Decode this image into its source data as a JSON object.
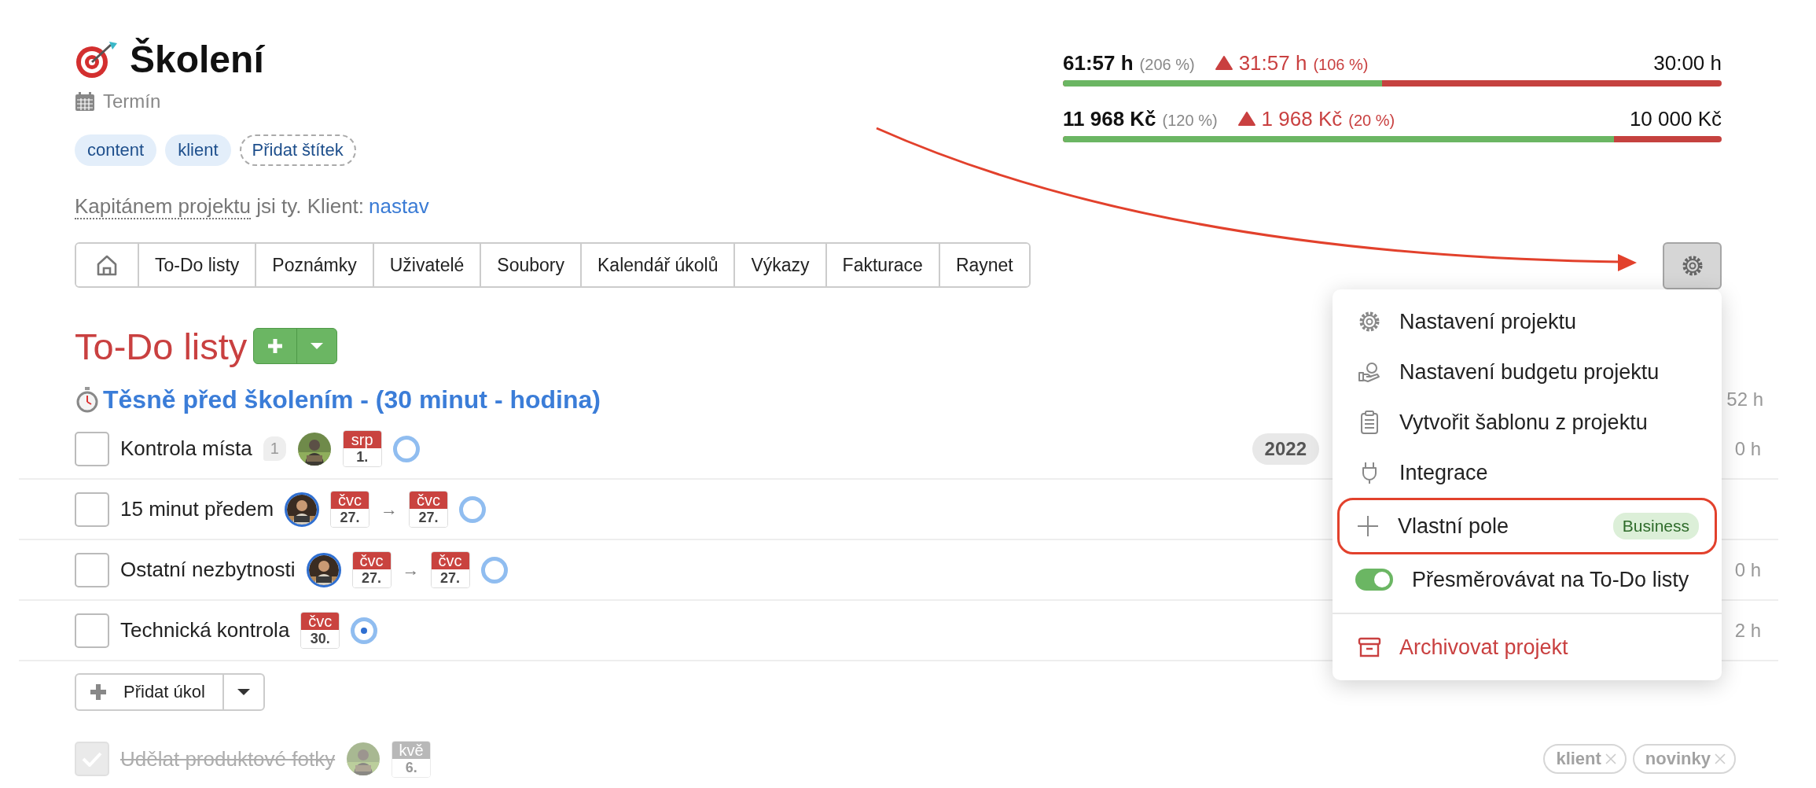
{
  "project": {
    "title": "Školení",
    "due_label": "Termín",
    "tags": [
      {
        "label": "content"
      },
      {
        "label": "klient"
      }
    ],
    "add_tag": "Přidat štítek",
    "owner_note": {
      "underlined": "Kapitánem projektu",
      "rest": "jsi ty. Klient:",
      "link": "nastav"
    }
  },
  "budgets": [
    {
      "spent": "61:57 h",
      "spent_share": "(206 %)",
      "over": "31:57 h",
      "over_share": "(106 %)",
      "limit": "30:00 h",
      "level": 0.484
    },
    {
      "spent": "11 968 Kč",
      "spent_share": "(120 %)",
      "over": "1 968 Kč",
      "over_share": "(20 %)",
      "limit": "10 000 Kč",
      "level": 0.836
    }
  ],
  "tabs": [
    {
      "kind": "home",
      "selected": false
    },
    {
      "kind": "text",
      "label": "To-Do listy",
      "selected": false
    },
    {
      "kind": "text",
      "label": "Poznámky",
      "selected": false
    },
    {
      "kind": "text",
      "label": "Uživatelé",
      "selected": false
    },
    {
      "kind": "text",
      "label": "Soubory",
      "selected": false
    },
    {
      "kind": "text",
      "label": "Kalendář úkolů",
      "selected": false
    },
    {
      "kind": "text",
      "label": "Výkazy",
      "selected": false
    },
    {
      "kind": "text",
      "label": "Fakturace",
      "selected": false
    },
    {
      "kind": "text",
      "label": "Raynet",
      "selected": false
    }
  ],
  "todo": {
    "heading": "To-Do listy",
    "group": {
      "title": "Těsně před školením - (30 minut - hodina)",
      "total": "52 h"
    },
    "tasks": [
      {
        "title": "Kontrola místa",
        "checked": false,
        "comments": "1",
        "assignee": {
          "highlighted": false
        },
        "dates": [
          {
            "month": "srp",
            "day": "1."
          }
        ],
        "started": false,
        "badge": "2022",
        "hours": "0 h"
      },
      {
        "title": "15 minut předem",
        "checked": false,
        "assignee": {
          "highlighted": true
        },
        "dates": [
          {
            "month": "čvc",
            "day": "27."
          },
          {
            "month": "čvc",
            "day": "27."
          }
        ],
        "date_separator": "→",
        "started": false
      },
      {
        "title": "Ostatní nezbytnosti",
        "checked": false,
        "assignee": {
          "highlighted": true
        },
        "dates": [
          {
            "month": "čvc",
            "day": "27."
          },
          {
            "month": "čvc",
            "day": "27."
          }
        ],
        "date_separator": "→",
        "started": false,
        "hours": "0 h"
      },
      {
        "title": "Technická kontrola",
        "checked": false,
        "dates": [
          {
            "month": "čvc",
            "day": "30."
          }
        ],
        "started": true,
        "hours": "2 h"
      }
    ],
    "add_task": "Přidat úkol",
    "completed": [
      {
        "title": "Udělat produktové fotky",
        "checked": true,
        "assignee": {
          "highlighted": false
        },
        "dates": [
          {
            "month": "kvě",
            "day": "6."
          }
        ],
        "tags": [
          {
            "label": "klient"
          },
          {
            "label": "novinky"
          }
        ]
      }
    ]
  },
  "menu": {
    "items": [
      {
        "kind": "item",
        "label": "Nastavení projektu",
        "outlined": false
      },
      {
        "kind": "item",
        "label": "Nastavení budgetu projektu",
        "outlined": false
      },
      {
        "kind": "item",
        "label": "Vytvořit šablonu z projektu",
        "outlined": false
      },
      {
        "kind": "item",
        "label": "Integrace",
        "outlined": false
      },
      {
        "kind": "item",
        "label": "Vlastní pole",
        "badge": "Business",
        "outlined": true
      },
      {
        "kind": "toggle",
        "label": "Přesměrovávat na To-Do listy",
        "on": true,
        "outlined": false
      },
      {
        "kind": "danger",
        "label": "Archivovat projekt",
        "outlined": false
      }
    ]
  }
}
